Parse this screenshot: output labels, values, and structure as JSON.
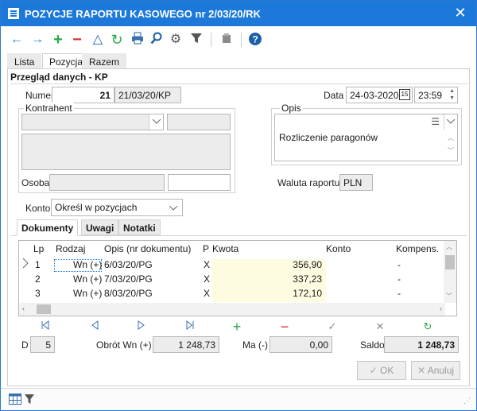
{
  "window": {
    "title": "POZYCJE RAPORTU KASOWEGO nr 2/03/20/RK",
    "close_glyph": "✕"
  },
  "toolbar": {
    "icons": [
      "arrow-left-icon",
      "arrow-right-icon",
      "plus-icon",
      "minus-icon",
      "triangle-icon",
      "refresh-icon",
      "printer-icon",
      "magnifier-icon",
      "gears-icon",
      "filter-icon",
      "clip-icon",
      "help-icon"
    ]
  },
  "tabs": [
    "Lista",
    "Pozycja",
    "Razem"
  ],
  "section_title": "Przegląd danych - KP",
  "numer": {
    "label": "Numer",
    "value": "21",
    "doc": "21/03/20/KP"
  },
  "data": {
    "label": "Data",
    "date": "24-03-2020",
    "time": "23:59",
    "calendar_glyph": "15"
  },
  "kontrahent": {
    "label": "Kontrahent",
    "osoba_label": "Osoba"
  },
  "opis": {
    "label": "Opis",
    "text": "Rozliczenie paragonów"
  },
  "waluta": {
    "label": "Waluta raportu",
    "value": "PLN"
  },
  "konto": {
    "label": "Konto",
    "value": "Określ w pozycjach"
  },
  "subtabs": [
    "Dokumenty",
    "Uwagi",
    "Notatki"
  ],
  "grid": {
    "headers": [
      "Lp",
      "Rodzaj",
      "Opis (nr dokumentu)",
      "P",
      "Kwota",
      "Konto",
      "Kompens."
    ],
    "rows": [
      {
        "lp": "1",
        "rodzaj": "Wn (+)",
        "opis": "6/03/20/PG",
        "p": "X",
        "kwota": "356,90",
        "konto": "",
        "komp": "-"
      },
      {
        "lp": "2",
        "rodzaj": "Wn (+)",
        "opis": "7/03/20/PG",
        "p": "X",
        "kwota": "337,23",
        "konto": "",
        "komp": "-"
      },
      {
        "lp": "3",
        "rodzaj": "Wn (+)",
        "opis": "8/03/20/PG",
        "p": "X",
        "kwota": "172,10",
        "konto": "",
        "komp": "-"
      }
    ]
  },
  "summary": {
    "d_label": "D",
    "d_value": "5",
    "obrot_label": "Obrót Wn (+)",
    "obrot_value": "1 248,73",
    "ma_label": "Ma (-)",
    "ma_value": "0,00",
    "saldo_label": "Saldo",
    "saldo_value": "1 248,73"
  },
  "buttons": {
    "ok": "OK",
    "anuluj": "Anuluj"
  },
  "colors": {
    "accent": "#1c79d9",
    "green": "#2aa84a",
    "red": "#d23030"
  }
}
